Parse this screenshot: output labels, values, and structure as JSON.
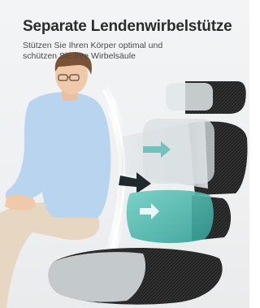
{
  "header": {
    "title": "Separate Lendenwirbelstütze",
    "subtitle_line1": "Stützen Sie Ihren Körper optimal und",
    "subtitle_line2": "schützen Sie Ihre Wirbelsäule"
  },
  "colors": {
    "background": "#eef0f1",
    "title": "#2b2b2b",
    "subtitle": "#4a4a4a",
    "shirt": "#b9d4ee",
    "trousers": "#e6d6c2",
    "hair": "#7a5236",
    "skin": "#f0c9ab",
    "chair_mesh": "#1e1e1e",
    "highlight_teal": "#4fb6ad"
  },
  "icons": {
    "arrow_upper": "arrow-right-icon",
    "arrow_lower": "arrow-right-icon"
  }
}
